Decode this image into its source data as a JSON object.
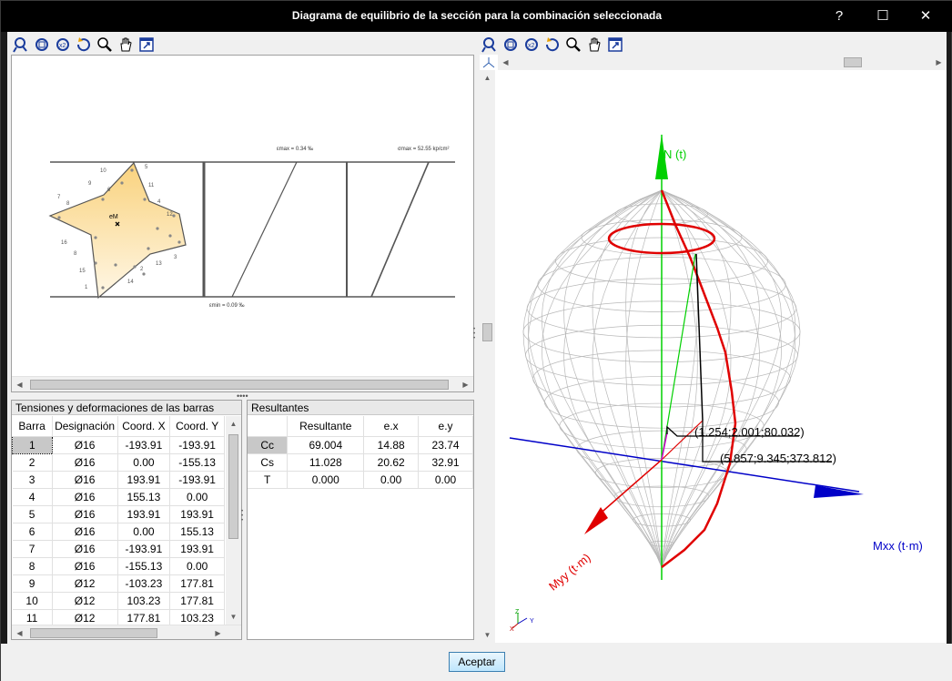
{
  "window": {
    "title": "Diagrama de equilibrio de la sección para la combinación seleccionada",
    "help_glyph": "?",
    "maximize_glyph": "☐",
    "close_glyph": "✕"
  },
  "toolbar_icons": [
    "zoom-extents-icon",
    "zoom-window-icon",
    "zoom-x2-icon",
    "refresh-zoom-icon",
    "zoom-icon",
    "pan-hand-icon",
    "export-view-icon"
  ],
  "section_diagram": {
    "label_emax": "εmax = 0.34 ‰",
    "label_sigma_max": "σmax = 52.55 kp/cm²",
    "label_emin": "εmin = 0.09 ‰",
    "label_center": "eM",
    "bar_numbers": [
      "10",
      "5",
      "9",
      "11",
      "6",
      "7",
      "4",
      "8",
      "12",
      "16",
      "8",
      "13",
      "3",
      "15",
      "2",
      "14",
      "1"
    ]
  },
  "bars_table": {
    "title": "Tensiones y deformaciones de las barras",
    "headers": [
      "Barra",
      "Designación",
      "Coord. X",
      "Coord. Y"
    ],
    "rows": [
      [
        "1",
        "Ø16",
        "-193.91",
        "-193.91"
      ],
      [
        "2",
        "Ø16",
        "0.00",
        "-155.13"
      ],
      [
        "3",
        "Ø16",
        "193.91",
        "-193.91"
      ],
      [
        "4",
        "Ø16",
        "155.13",
        "0.00"
      ],
      [
        "5",
        "Ø16",
        "193.91",
        "193.91"
      ],
      [
        "6",
        "Ø16",
        "0.00",
        "155.13"
      ],
      [
        "7",
        "Ø16",
        "-193.91",
        "193.91"
      ],
      [
        "8",
        "Ø16",
        "-155.13",
        "0.00"
      ],
      [
        "9",
        "Ø12",
        "-103.23",
        "177.81"
      ],
      [
        "10",
        "Ø12",
        "103.23",
        "177.81"
      ],
      [
        "11",
        "Ø12",
        "177.81",
        "103.23"
      ]
    ]
  },
  "results_table": {
    "title": "Resultantes",
    "headers": [
      "",
      "Resultante",
      "e.x",
      "e.y"
    ],
    "rows": [
      [
        "Cc",
        "69.004",
        "14.88",
        "23.74"
      ],
      [
        "Cs",
        "11.028",
        "20.62",
        "32.91"
      ],
      [
        "T",
        "0.000",
        "0.00",
        "0.00"
      ]
    ]
  },
  "diagram3d": {
    "axis_n": "N (t)",
    "axis_mxx": "Mxx (t·m)",
    "axis_myy": "Myy (t·m)",
    "point1": "(1.254;2.001;80.032)",
    "point2": "(5.857;9.345;373.812)",
    "triad_z": "Z",
    "triad_x": "X",
    "triad_y": "Y"
  },
  "footer": {
    "accept_label": "Aceptar"
  },
  "colors": {
    "axis_green": "#00d000",
    "axis_blue": "#0000c8",
    "axis_red": "#e00000",
    "section_fill": "#fde7a8"
  }
}
